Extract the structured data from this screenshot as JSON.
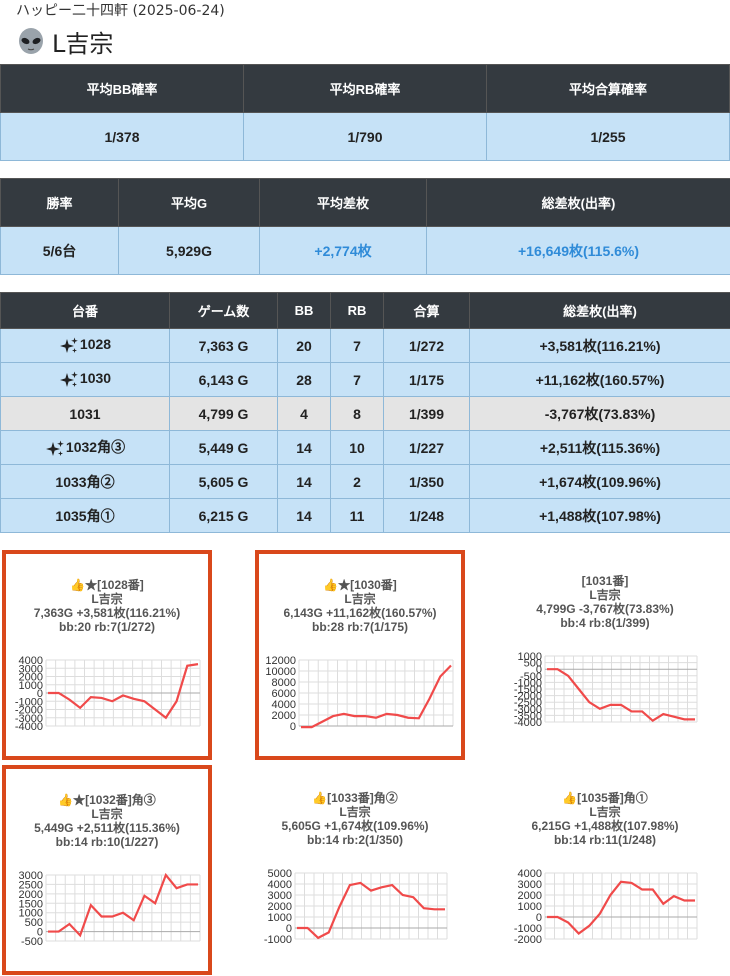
{
  "header": {
    "subtitle": "ハッピー二十四軒 (2025-06-24)",
    "title": "L吉宗"
  },
  "probabilities": {
    "headers": [
      "平均BB確率",
      "平均RB確率",
      "平均合算確率"
    ],
    "values": [
      "1/378",
      "1/790",
      "1/255"
    ]
  },
  "summary": {
    "headers": [
      "勝率",
      "平均G",
      "平均差枚",
      "総差枚(出率)"
    ],
    "values": [
      "5/6台",
      "5,929G",
      "+2,774枚",
      "+16,649枚(115.6%)"
    ]
  },
  "units": {
    "headers": [
      "台番",
      "ゲーム数",
      "BB",
      "RB",
      "合算",
      "総差枚(出率)"
    ],
    "rows": [
      {
        "num": "1028",
        "games": "7,363 G",
        "bb": "20",
        "rb": "7",
        "total": "1/272",
        "diff": "+3,581枚(116.21%)",
        "sparkle": true,
        "gray": false
      },
      {
        "num": "1030",
        "games": "6,143 G",
        "bb": "28",
        "rb": "7",
        "total": "1/175",
        "diff": "+11,162枚(160.57%)",
        "sparkle": true,
        "gray": false
      },
      {
        "num": "1031",
        "games": "4,799 G",
        "bb": "4",
        "rb": "8",
        "total": "1/399",
        "diff": "-3,767枚(73.83%)",
        "sparkle": false,
        "gray": true
      },
      {
        "num": "1032角③",
        "games": "5,449 G",
        "bb": "14",
        "rb": "10",
        "total": "1/227",
        "diff": "+2,511枚(115.36%)",
        "sparkle": true,
        "gray": false
      },
      {
        "num": "1033角②",
        "games": "5,605 G",
        "bb": "14",
        "rb": "2",
        "total": "1/350",
        "diff": "+1,674枚(109.96%)",
        "sparkle": false,
        "gray": false
      },
      {
        "num": "1035角①",
        "games": "6,215 G",
        "bb": "14",
        "rb": "11",
        "total": "1/248",
        "diff": "+1,488枚(107.98%)",
        "sparkle": false,
        "gray": false
      }
    ]
  },
  "colors": {
    "header_bg": "#343a40",
    "cell_bg": "#c6e2f7",
    "gray_bg": "#e4e4e4",
    "positive_blue": "#2f8bd8",
    "highlight_border": "#d9481b",
    "line": "#f04a4a"
  },
  "chart_data": [
    {
      "type": "line",
      "title_lines": [
        "👍★[1028番]",
        "L吉宗",
        "7,363G +3,581枚(116.21%)",
        "bb:20 rb:7(1/272)"
      ],
      "yticks": [
        4000,
        3000,
        2000,
        1000,
        0,
        -1000,
        -2000,
        -3000,
        -4000
      ],
      "ylim": [
        -4000,
        4000
      ],
      "values": [
        0,
        0,
        -800,
        -1800,
        -500,
        -600,
        -1000,
        -300,
        -700,
        -1000,
        -2000,
        -3000,
        -1000,
        3300,
        3500
      ],
      "highlight": true
    },
    {
      "type": "line",
      "title_lines": [
        "👍★[1030番]",
        "L吉宗",
        "6,143G +11,162枚(160.57%)",
        "bb:28 rb:7(1/175)"
      ],
      "yticks": [
        12000,
        10000,
        8000,
        6000,
        4000,
        2000,
        0
      ],
      "ylim": [
        0,
        12000
      ],
      "values": [
        -200,
        -200,
        800,
        1800,
        2200,
        1800,
        1800,
        1500,
        2200,
        2000,
        1500,
        1400,
        5000,
        9000,
        11000
      ],
      "highlight": true
    },
    {
      "type": "line",
      "title_lines": [
        "[1031番]",
        "L吉宗",
        "4,799G -3,767枚(73.83%)",
        "bb:4 rb:8(1/399)"
      ],
      "yticks": [
        1000,
        500,
        0,
        -500,
        -1000,
        -1500,
        -2000,
        -2500,
        -3000,
        -3500,
        -4000
      ],
      "ylim": [
        -4000,
        1000
      ],
      "values": [
        0,
        0,
        -500,
        -1500,
        -2500,
        -3000,
        -2700,
        -2700,
        -3200,
        -3200,
        -3900,
        -3400,
        -3600,
        -3800,
        -3800
      ],
      "highlight": false
    },
    {
      "type": "line",
      "title_lines": [
        "👍★[1032番]角③",
        "L吉宗",
        "5,449G +2,511枚(115.36%)",
        "bb:14 rb:10(1/227)"
      ],
      "yticks": [
        3000,
        2500,
        2000,
        1500,
        1000,
        500,
        0,
        -500
      ],
      "ylim": [
        -500,
        3000
      ],
      "values": [
        0,
        0,
        400,
        -200,
        1400,
        800,
        800,
        1000,
        600,
        1900,
        1500,
        3000,
        2300,
        2500,
        2500
      ],
      "highlight": true
    },
    {
      "type": "line",
      "title_lines": [
        "👍[1033番]角②",
        "L吉宗",
        "5,605G +1,674枚(109.96%)",
        "bb:14 rb:2(1/350)"
      ],
      "yticks": [
        5000,
        4000,
        3000,
        2000,
        1000,
        0,
        -1000
      ],
      "ylim": [
        -1000,
        5000
      ],
      "values": [
        0,
        0,
        -900,
        -400,
        1900,
        3900,
        4100,
        3400,
        3700,
        3900,
        3000,
        2800,
        1800,
        1700,
        1700
      ],
      "highlight": false
    },
    {
      "type": "line",
      "title_lines": [
        "👍[1035番]角①",
        "L吉宗",
        "6,215G +1,488枚(107.98%)",
        "bb:14 rb:11(1/248)"
      ],
      "yticks": [
        4000,
        3000,
        2000,
        1000,
        0,
        -1000,
        -2000
      ],
      "ylim": [
        -2000,
        4000
      ],
      "values": [
        0,
        0,
        -500,
        -1500,
        -800,
        300,
        2000,
        3200,
        3100,
        2500,
        2500,
        1200,
        1900,
        1500,
        1500
      ],
      "highlight": false
    }
  ]
}
